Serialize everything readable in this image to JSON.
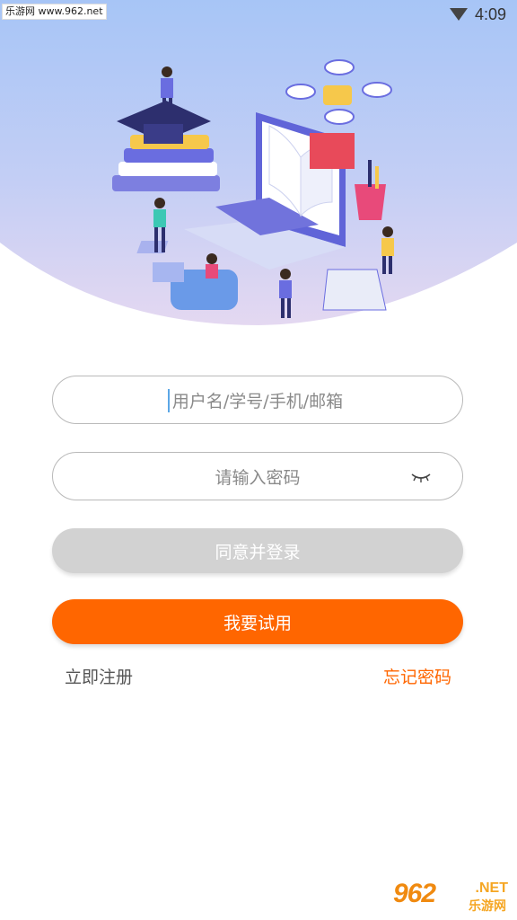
{
  "status_bar": {
    "watermark_text": "乐游网 www.962.net",
    "time": "4:09"
  },
  "hero": {
    "illustration": "education-illustration"
  },
  "login_form": {
    "username_placeholder": "用户名/学号/手机/邮箱",
    "password_placeholder": "请输入密码",
    "login_button": "同意并登录",
    "trial_button": "我要试用",
    "register_link": "立即注册",
    "forgot_link": "忘记密码"
  },
  "bottom_watermark": {
    "logo_number": "962",
    "logo_net": ".NET",
    "logo_cn": "乐游网"
  },
  "colors": {
    "accent": "#ff6600",
    "disabled_button": "#d2d2d2",
    "hero_gradient_top": "#a9c6f5",
    "hero_gradient_bottom": "#ddd4f0"
  }
}
